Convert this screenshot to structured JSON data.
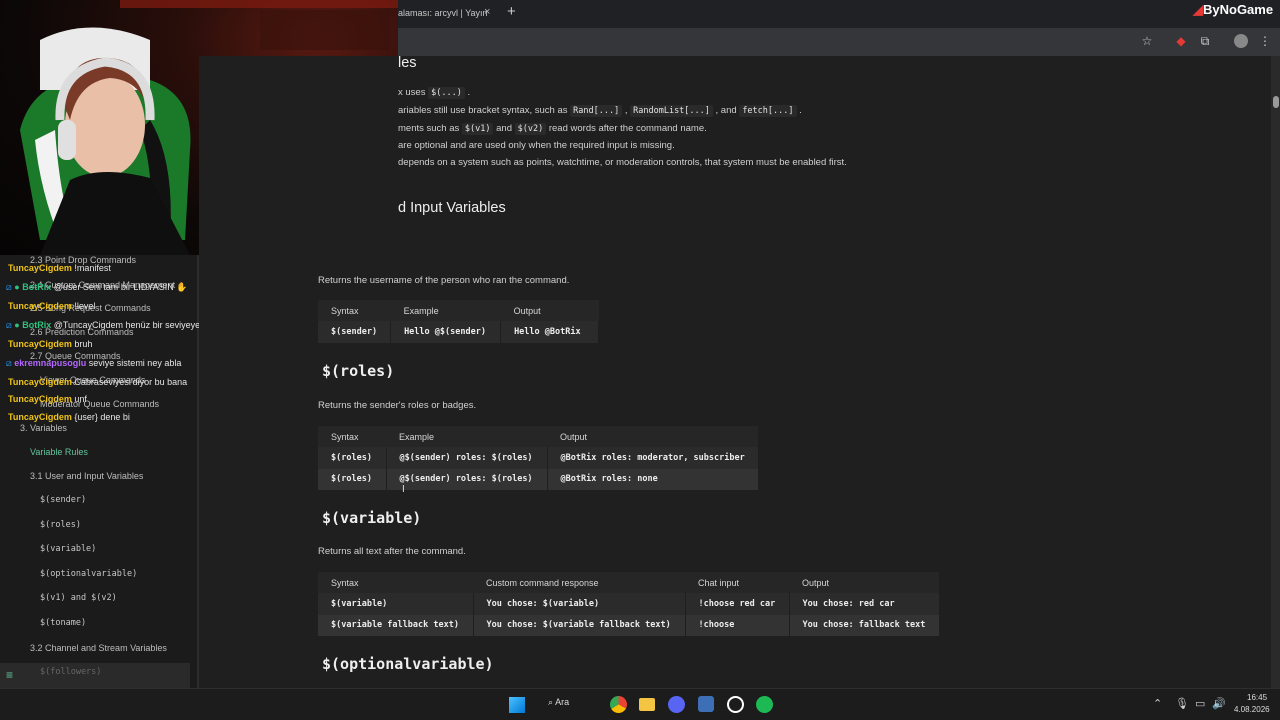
{
  "browser": {
    "tab_title": "alaması: arcyvl | Yayın",
    "tab_close": "×",
    "new_tab": "+",
    "watermark": "ByNoGame"
  },
  "sidebar": {
    "nav": [
      {
        "label": "2.3 Point Drop Commands"
      },
      {
        "label": "2.4 Custom Command Management"
      },
      {
        "label": "2.5 Song Request Commands"
      },
      {
        "label": "2.6 Prediction Commands"
      },
      {
        "label": "2.7 Queue Commands"
      },
      {
        "label": "Viewer Queue Commands"
      },
      {
        "label": "Moderator Queue Commands"
      },
      {
        "label": "3. Variables"
      },
      {
        "label": "Variable Rules"
      },
      {
        "label": "3.1 User and Input Variables"
      },
      {
        "label": "$(sender)"
      },
      {
        "label": "$(roles)"
      },
      {
        "label": "$(variable)"
      },
      {
        "label": "$(optionalvariable)"
      },
      {
        "label": "$(v1) and $(v2)"
      },
      {
        "label": "$(toname)"
      },
      {
        "label": "3.2 Channel and Stream Variables"
      },
      {
        "label": "$(followers)"
      }
    ],
    "chat": [
      {
        "user": "TuncayCigdem",
        "text": "!manifest"
      },
      {
        "user": "BotRix",
        "text": "@user Seni tanı bir LIDYASIN"
      },
      {
        "user": "TuncayCigdem",
        "text": "!level"
      },
      {
        "user": "BotRix",
        "text": "@TuncayCigdem henüz bir seviyeye ulaşmadı."
      },
      {
        "user": "TuncayCigdem",
        "text": "bruh"
      },
      {
        "user": "ekremnapusoglu",
        "text": "seviye sistemi ney abla"
      },
      {
        "user": "TuncayCigdem",
        "text": "Cabraseviyesi'diyor bu bana"
      },
      {
        "user": "TuncayCigdem",
        "text": "unf"
      },
      {
        "user": "TuncayCigdem",
        "text": "{user} dene bi"
      }
    ]
  },
  "main": {
    "section_title_partial": "les",
    "rules": [
      {
        "a": "x uses ",
        "code": "$(...)",
        "b": " ."
      },
      {
        "a": "ariables still use bracket syntax, such as ",
        "code1": "Rand[...]",
        "m1": " , ",
        "code2": "RandomList[...]",
        "m2": " , and ",
        "code3": "fetch[...]",
        "b": " ."
      },
      {
        "a": "ments such as ",
        "code1": "$(v1)",
        "m1": " and ",
        "code2": "$(v2)",
        "b": " read words after the command name."
      },
      {
        "a": "are optional and are used only when the required input is missing."
      },
      {
        "a": "depends on a system such as points, watchtime, or moderation controls, that system must be enabled first."
      }
    ],
    "subsection_title_partial": "d Input Variables",
    "sender": {
      "desc": "Returns the username of the person who ran the command.",
      "headers": [
        "Syntax",
        "Example",
        "Output"
      ],
      "rows": [
        [
          "$(sender)",
          "Hello @$(sender)",
          "Hello @BotRix"
        ]
      ]
    },
    "roles": {
      "title": "$(roles)",
      "desc": "Returns the sender's roles or badges.",
      "headers": [
        "Syntax",
        "Example",
        "Output"
      ],
      "rows": [
        [
          "$(roles)",
          "@$(sender) roles: $(roles)",
          "@BotRix roles: moderator, subscriber"
        ],
        [
          "$(roles)",
          "@$(sender) roles: $(roles)",
          "@BotRix roles: none"
        ]
      ]
    },
    "variable": {
      "title": "$(variable)",
      "desc": "Returns all text after the command.",
      "headers": [
        "Syntax",
        "Custom command response",
        "Chat input",
        "Output"
      ],
      "rows": [
        [
          "$(variable)",
          "You chose: $(variable)",
          "!choose red car",
          "You chose: red car"
        ],
        [
          "$(variable fallback text)",
          "You chose: $(variable fallback text)",
          "!choose",
          "You chose: fallback text"
        ]
      ]
    },
    "optionalvariable": {
      "title": "$(optionalvariable)"
    }
  },
  "taskbar": {
    "search_label": "Ara",
    "time": "16:45",
    "date": "4.08.2026"
  },
  "colors": {
    "accent": "#63c59e",
    "botrix": "#2ec27e",
    "tuncay": "#f0c419",
    "ekrem": "#b266ff"
  }
}
